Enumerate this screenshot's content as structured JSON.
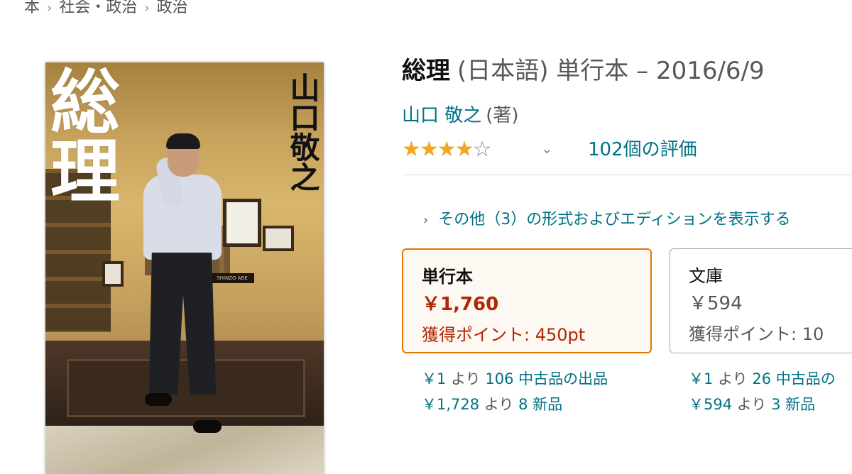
{
  "breadcrumb": {
    "items": [
      "本",
      "社会・政治",
      "政治"
    ],
    "separator": "›"
  },
  "cover": {
    "title_text": "総理",
    "author_text": "山口敬之",
    "nameplate_text": "SHINZO ABE"
  },
  "product": {
    "title": "総理",
    "title_detail": "(日本語) 単行本 – 2016/6/9",
    "author_name": "山口 敬之",
    "author_role": "(著)",
    "rating": {
      "stars_value": 4,
      "stars_max": 5,
      "count_label": "102個の評価",
      "star_color": "#f2a71e"
    }
  },
  "formats_link": "その他（3）の形式およびエディションを表示する",
  "swatches": [
    {
      "format": "単行本",
      "price": "￥1,760",
      "points": "獲得ポイント: 450pt",
      "selected": true,
      "accent": "#e77600",
      "price_color": "#b12704"
    },
    {
      "format": "文庫",
      "price": "￥594",
      "points": "獲得ポイント: 10",
      "selected": false
    }
  ],
  "offers": [
    {
      "used_price": "￥1",
      "used_yori": "より",
      "used_count": "106 中古品の出品",
      "new_price": "￥1,728",
      "new_yori": "より",
      "new_count": "8 新品"
    },
    {
      "used_price": "￥1",
      "used_yori": "より",
      "used_count": "26 中古品の",
      "new_price": "￥594",
      "new_yori": "より",
      "new_count": "3 新品"
    }
  ],
  "link_color": "#007185"
}
